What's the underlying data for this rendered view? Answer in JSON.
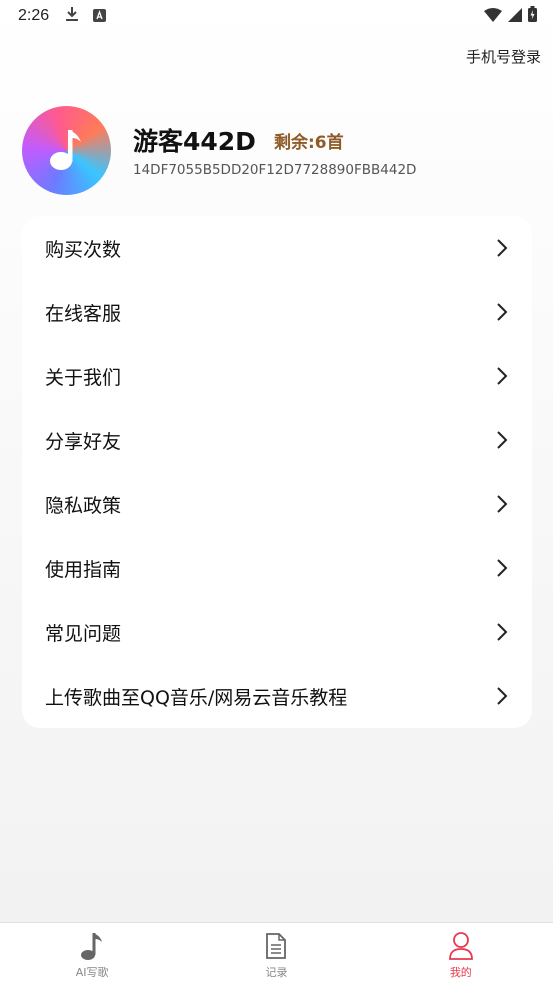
{
  "status_bar": {
    "time": "2:26"
  },
  "header": {
    "login_link": "手机号登录"
  },
  "profile": {
    "username": "游客442D",
    "remaining": "剩余:6首",
    "device_id": "14DF7055B5DD20F12D7728890FBB442D"
  },
  "menu": {
    "items": [
      {
        "label": "购买次数"
      },
      {
        "label": "在线客服"
      },
      {
        "label": "关于我们"
      },
      {
        "label": "分享好友"
      },
      {
        "label": "隐私政策"
      },
      {
        "label": "使用指南"
      },
      {
        "label": "常见问题"
      },
      {
        "label": "上传歌曲至QQ音乐/网易云音乐教程"
      }
    ]
  },
  "bottom_nav": {
    "tabs": [
      {
        "label": "AI写歌",
        "icon": "music-note-icon"
      },
      {
        "label": "记录",
        "icon": "document-icon"
      },
      {
        "label": "我的",
        "icon": "person-icon",
        "active": true
      }
    ]
  },
  "colors": {
    "accent": "#e8384f",
    "remaining": "#8f5a26"
  }
}
